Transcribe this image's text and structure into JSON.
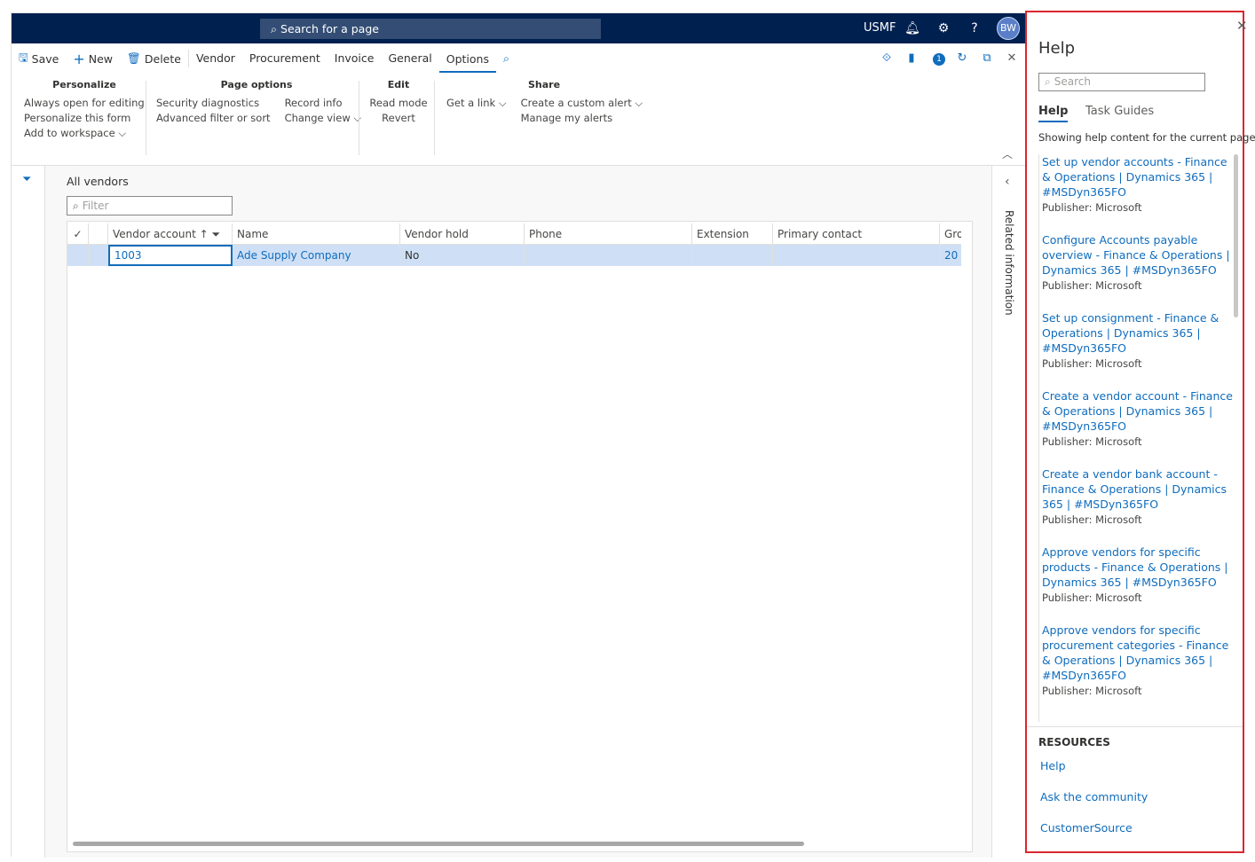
{
  "topbar": {
    "search_placeholder": "Search for a page",
    "company": "USMF",
    "avatar_initials": "BW"
  },
  "actionpane": {
    "save": "Save",
    "new": "New",
    "delete": "Delete",
    "tabs": [
      "Vendor",
      "Procurement",
      "Invoice",
      "General",
      "Options"
    ],
    "active_tab": "Options",
    "notification_count": "1"
  },
  "ribbon": {
    "personalize": {
      "title": "Personalize",
      "items": [
        "Always open for editing",
        "Personalize this form",
        "Add to workspace"
      ]
    },
    "page_options": {
      "title": "Page options",
      "col1": [
        "Security diagnostics",
        "Advanced filter or sort"
      ],
      "col2": [
        "Record info",
        "Change view"
      ]
    },
    "edit": {
      "title": "Edit",
      "items": [
        "Read mode",
        "Revert"
      ]
    },
    "share": {
      "title": "Share",
      "get_link": "Get a link",
      "items": [
        "Create a custom alert",
        "Manage my alerts"
      ]
    }
  },
  "grid": {
    "title": "All vendors",
    "filter_placeholder": "Filter",
    "columns": [
      "Vendor account",
      "Name",
      "Vendor hold",
      "Phone",
      "Extension",
      "Primary contact",
      "Gro"
    ],
    "rows": [
      [
        "1003",
        "Ade Supply Company",
        "No",
        "",
        "",
        "",
        "20"
      ]
    ]
  },
  "related": {
    "label": "Related information"
  },
  "help": {
    "title": "Help",
    "search_placeholder": "Search",
    "tabs": [
      "Help",
      "Task Guides"
    ],
    "note": "Showing help content for the current page",
    "articles": [
      {
        "lines": [
          "Set up vendor accounts - Finance",
          "& Operations | Dynamics 365 |",
          "#MSDyn365FO"
        ],
        "publisher": "Publisher: Microsoft"
      },
      {
        "lines": [
          "Configure Accounts payable",
          "overview - Finance & Operations |",
          "Dynamics 365 | #MSDyn365FO"
        ],
        "publisher": "Publisher: Microsoft"
      },
      {
        "lines": [
          "Set up consignment - Finance &",
          "Operations | Dynamics 365 |",
          "#MSDyn365FO"
        ],
        "publisher": "Publisher: Microsoft"
      },
      {
        "lines": [
          "Create a vendor account - Finance",
          "& Operations | Dynamics 365 |",
          "#MSDyn365FO"
        ],
        "publisher": "Publisher: Microsoft"
      },
      {
        "lines": [
          "Create a vendor bank account -",
          "Finance & Operations | Dynamics",
          "365 | #MSDyn365FO"
        ],
        "publisher": "Publisher: Microsoft"
      },
      {
        "lines": [
          "Approve vendors for specific",
          "products - Finance & Operations |",
          "Dynamics 365 | #MSDyn365FO"
        ],
        "publisher": "Publisher: Microsoft"
      },
      {
        "lines": [
          "Approve vendors for specific",
          "procurement categories - Finance",
          "& Operations | Dynamics 365 |",
          "#MSDyn365FO"
        ],
        "publisher": "Publisher: Microsoft"
      }
    ],
    "resources_title": "RESOURCES",
    "resources": [
      "Help",
      "Ask the community",
      "CustomerSource"
    ]
  },
  "colors": {
    "navbar": "#002050",
    "accent": "#0f6cbd",
    "selected_row": "#cfe0f6",
    "help_border": "#d9262f"
  }
}
